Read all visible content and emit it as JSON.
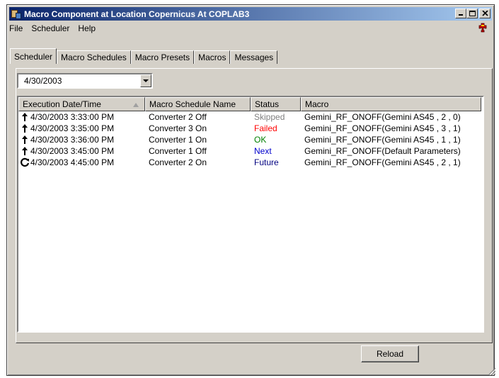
{
  "window": {
    "title": "Macro Component at Location Copernicus At COPLAB3"
  },
  "menu": [
    "File",
    "Scheduler",
    "Help"
  ],
  "tabs": [
    {
      "label": "Scheduler",
      "active": true
    },
    {
      "label": "Macro Schedules",
      "active": false
    },
    {
      "label": "Macro Presets",
      "active": false
    },
    {
      "label": "Macros",
      "active": false
    },
    {
      "label": "Messages",
      "active": false
    }
  ],
  "date_selector": {
    "value": "4/30/2003"
  },
  "table": {
    "columns": [
      "Execution Date/Time",
      "Macro Schedule Name",
      "Status",
      "Macro"
    ],
    "rows": [
      {
        "icon": "up-arrow-icon",
        "datetime": "4/30/2003 3:33:00 PM",
        "name": "Converter 2 Off",
        "status": "Skipped",
        "status_color": "#808080",
        "macro": "Gemini_RF_ONOFF(Gemini AS45 , 2 , 0)"
      },
      {
        "icon": "up-arrow-icon",
        "datetime": "4/30/2003 3:35:00 PM",
        "name": "Converter 3 On",
        "status": "Failed",
        "status_color": "#ff0000",
        "macro": "Gemini_RF_ONOFF(Gemini AS45 , 3 , 1)"
      },
      {
        "icon": "up-arrow-icon",
        "datetime": "4/30/2003 3:36:00 PM",
        "name": "Converter 1 On",
        "status": "OK",
        "status_color": "#008000",
        "macro": "Gemini_RF_ONOFF(Gemini AS45 , 1 , 1)"
      },
      {
        "icon": "up-arrow-icon",
        "datetime": "4/30/2003 3:45:00 PM",
        "name": "Converter 1 Off",
        "status": "Next",
        "status_color": "#0000cc",
        "macro": "Gemini_RF_ONOFF(Default Parameters)"
      },
      {
        "icon": "repeat-icon",
        "datetime": "4/30/2003 4:45:00 PM",
        "name": "Converter 2 On",
        "status": "Future",
        "status_color": "#000080",
        "macro": "Gemini_RF_ONOFF(Gemini AS45 , 2 , 1)"
      }
    ]
  },
  "buttons": {
    "reload": "Reload"
  }
}
